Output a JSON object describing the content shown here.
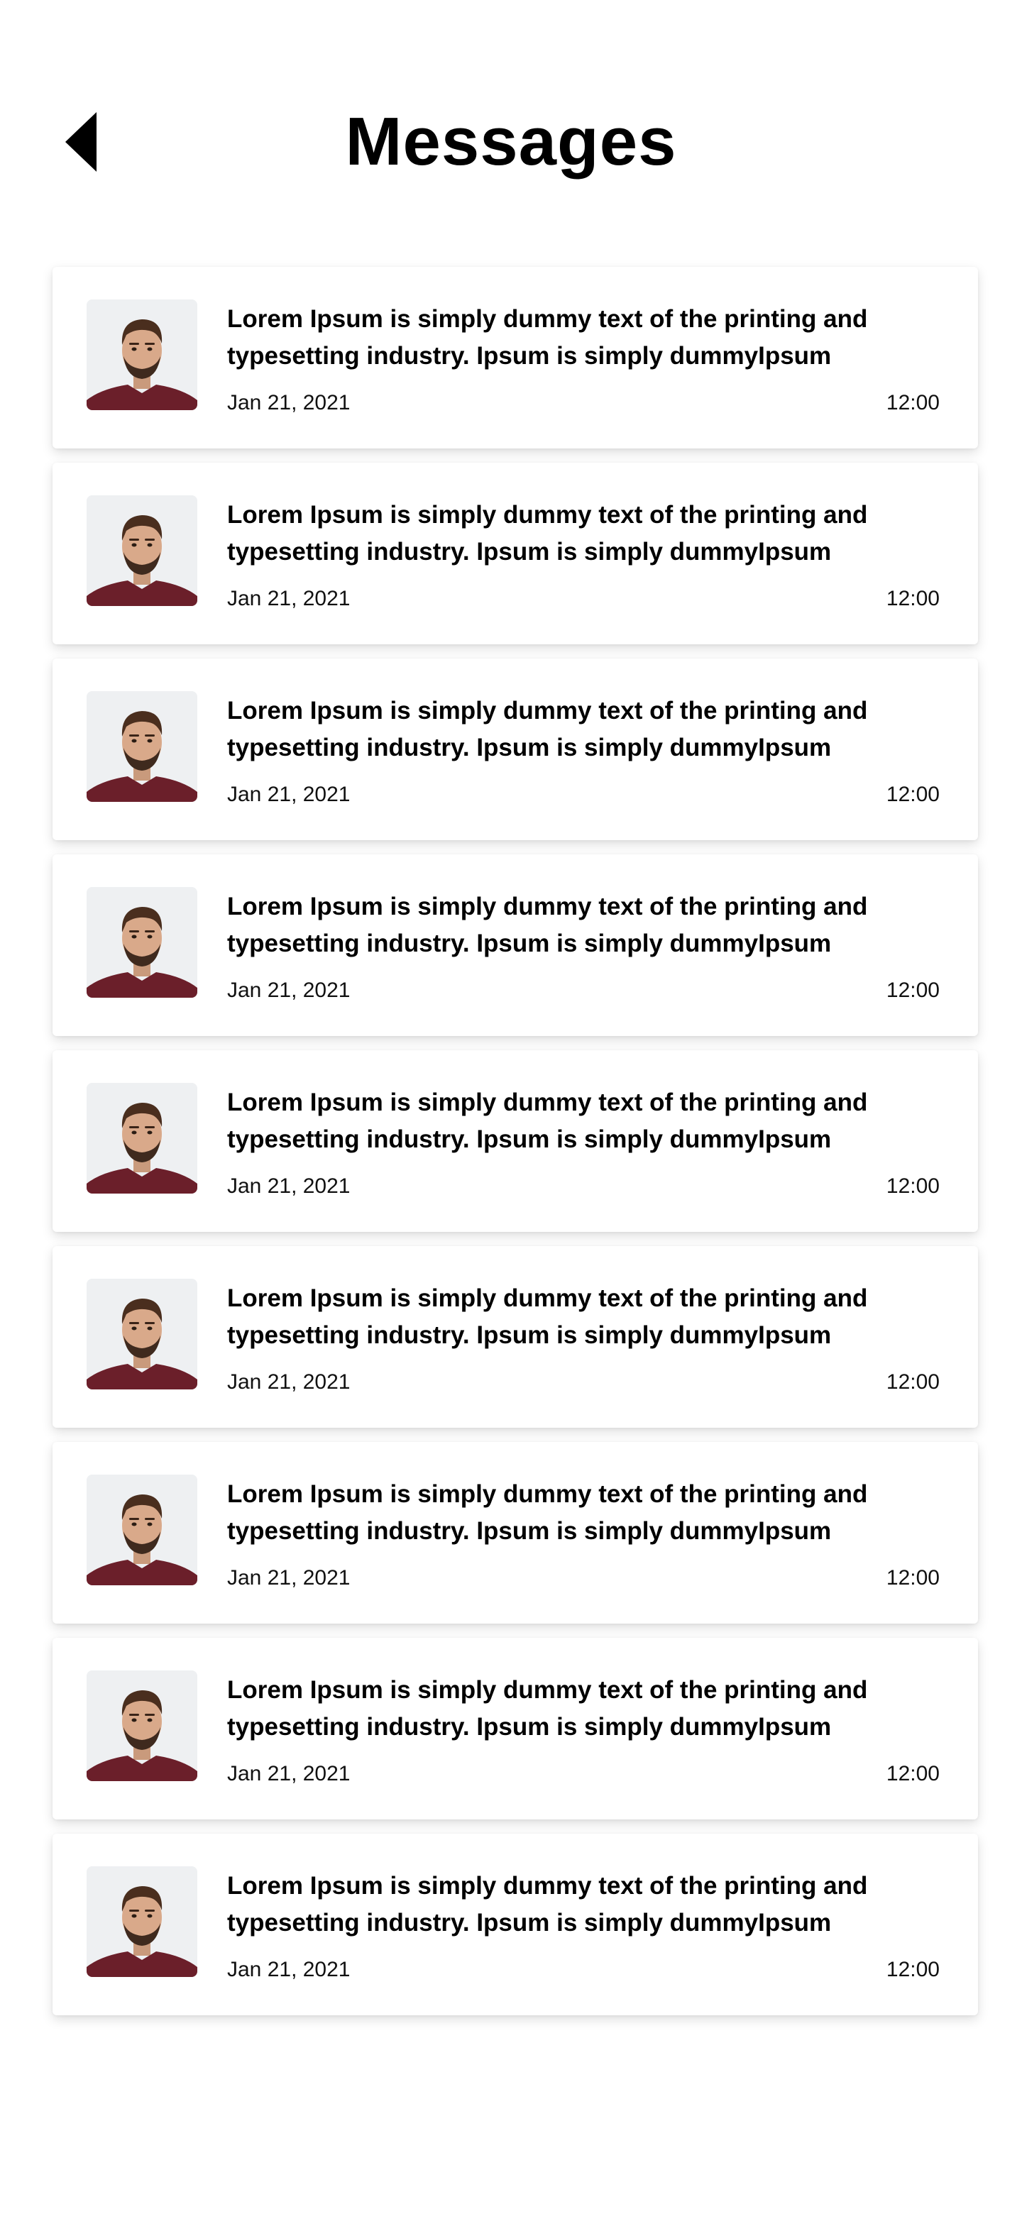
{
  "header": {
    "title": "Messages",
    "back_icon": "back-arrow-icon"
  },
  "messages": [
    {
      "text": "Lorem Ipsum is simply dummy text of the printing and typesetting industry. Ipsum is simply dummyIpsum",
      "date": "Jan 21, 2021",
      "time": "12:00"
    },
    {
      "text": "Lorem Ipsum is simply dummy text of the printing and typesetting industry. Ipsum is simply dummyIpsum",
      "date": "Jan 21, 2021",
      "time": "12:00"
    },
    {
      "text": "Lorem Ipsum is simply dummy text of the printing and typesetting industry. Ipsum is simply dummyIpsum",
      "date": "Jan 21, 2021",
      "time": "12:00"
    },
    {
      "text": "Lorem Ipsum is simply dummy text of the printing and typesetting industry. Ipsum is simply dummyIpsum",
      "date": "Jan 21, 2021",
      "time": "12:00"
    },
    {
      "text": "Lorem Ipsum is simply dummy text of the printing and typesetting industry. Ipsum is simply dummyIpsum",
      "date": "Jan 21, 2021",
      "time": "12:00"
    },
    {
      "text": "Lorem Ipsum is simply dummy text of the printing and typesetting industry. Ipsum is simply dummyIpsum",
      "date": "Jan 21, 2021",
      "time": "12:00"
    },
    {
      "text": "Lorem Ipsum is simply dummy text of the printing and typesetting industry. Ipsum is simply dummyIpsum",
      "date": "Jan 21, 2021",
      "time": "12:00"
    },
    {
      "text": "Lorem Ipsum is simply dummy text of the printing and typesetting industry. Ipsum is simply dummyIpsum",
      "date": "Jan 21, 2021",
      "time": "12:00"
    },
    {
      "text": "Lorem Ipsum is simply dummy text of the printing and typesetting industry. Ipsum is simply dummyIpsum",
      "date": "Jan 21, 2021",
      "time": "12:00"
    }
  ],
  "colors": {
    "background": "#ffffff",
    "text": "#000000",
    "avatar_shirt": "#6b1f2a"
  }
}
